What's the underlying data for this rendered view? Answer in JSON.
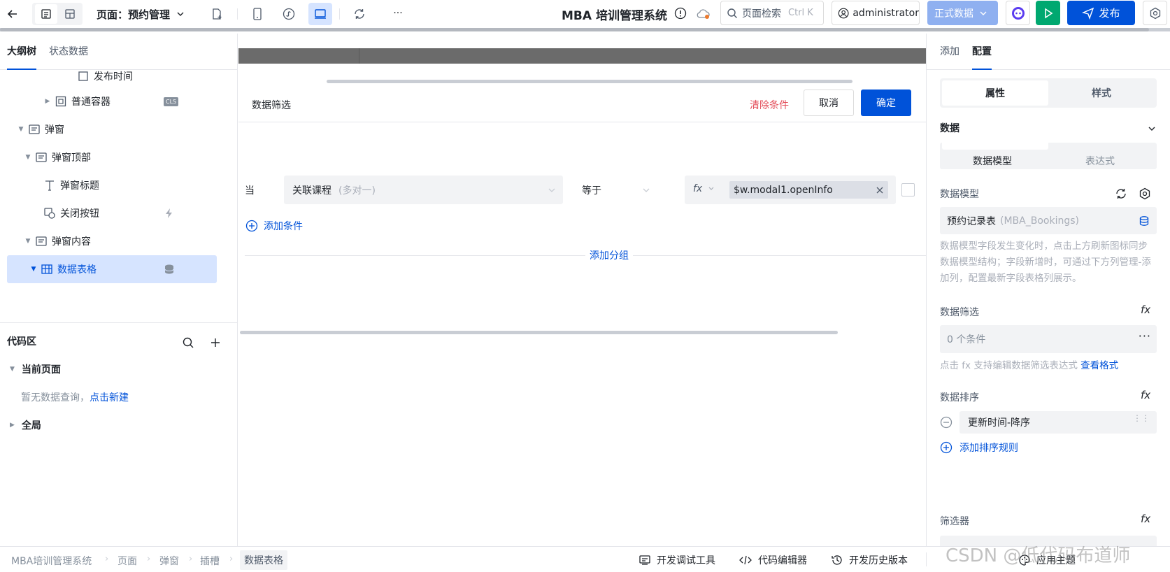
{
  "toolbar": {
    "page_label": "页面：预约管理",
    "app_title": "MBA 培训管理系统",
    "search_placeholder": "页面检索",
    "search_shortcut": "Ctrl K",
    "user": "administrator",
    "env_label": "正式数据",
    "publish_label": "发布",
    "more_label": "···"
  },
  "left": {
    "tabs": [
      "大纲树",
      "状态数据"
    ],
    "tree": [
      {
        "label": "发布时间",
        "icon": "checkbox-icon"
      },
      {
        "label": "普通容器",
        "icon": "container-icon",
        "badge": "CLS"
      },
      {
        "label": "弹窗",
        "icon": "modal-icon"
      },
      {
        "label": "弹窗顶部",
        "icon": "modal-icon"
      },
      {
        "label": "弹窗标题",
        "icon": "text-icon"
      },
      {
        "label": "关闭按钮",
        "icon": "button-icon"
      },
      {
        "label": "弹窗内容",
        "icon": "modal-icon"
      },
      {
        "label": "数据表格",
        "icon": "table-icon"
      }
    ],
    "code_area": {
      "title": "代码区",
      "current_page": "当前页面",
      "empty_text": "暂无数据查询，",
      "create_link": "点击新建",
      "global": "全局"
    }
  },
  "filter": {
    "title": "数据筛选",
    "clear_label": "清除条件",
    "cancel_label": "取消",
    "confirm_label": "确定",
    "when_label": "当",
    "field_value": "关联课程",
    "field_hint": "(多对一)",
    "operator": "等于",
    "fx_label": "fx",
    "expr_value": "$w.modal1.openInfo",
    "add_condition": "添加条件",
    "add_group": "添加分组"
  },
  "right": {
    "tabs": [
      "添加",
      "配置"
    ],
    "subtabs": [
      "属性",
      "样式"
    ],
    "data_section": "数据",
    "source_tabs": [
      "数据模型",
      "表达式"
    ],
    "model_label": "数据模型",
    "model_value": "预约记录表",
    "model_code": "(MBA_Bookings)",
    "model_help": "数据模型字段发生变化时，点击上方刷新图标同步数据模型结构；字段新增时，可通过下方列管理-添加列，配置最新字段表格列展示。",
    "filter_label": "数据筛选",
    "filter_value": "0 个条件",
    "filter_help": "点击 fx 支持编辑数据筛选表达式",
    "filter_help_link": "查看格式",
    "sort_label": "数据排序",
    "sort_value": "更新时间-降序",
    "add_sort": "添加排序规则",
    "selector_label": "筛选器"
  },
  "bottom": {
    "crumbs": [
      "MBA培训管理系统",
      "页面",
      "弹窗",
      "插槽",
      "数据表格"
    ],
    "dev_tools": "开发调试工具",
    "code_editor": "代码编辑器",
    "history": "开发历史版本",
    "theme": "应用主题",
    "watermark": "CSDN @低代码布道师"
  },
  "colors": {
    "primary": "#0052d9",
    "danger": "#e34d59",
    "publish_green": "#00a870",
    "env_blue": "#8fb0f0"
  }
}
